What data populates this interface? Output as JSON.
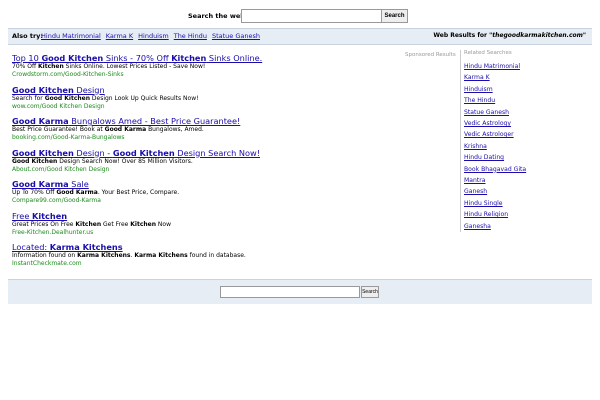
{
  "top_search": {
    "label": "Search the web:",
    "value": "",
    "button": "Search"
  },
  "also_try": {
    "label": "Also try:",
    "links": [
      "Hindu Matrimonial",
      "Karma K",
      "Hinduism",
      "The Hindu",
      "Statue Ganesh"
    ]
  },
  "web_results": {
    "prefix": "Web Results for",
    "query": "\"thegoodkarmakitchen.com\""
  },
  "sponsored_label": "Sponsored Results",
  "results": [
    {
      "title_parts": [
        [
          "Top 10 ",
          false
        ],
        [
          "Good Kitchen",
          true
        ],
        [
          " Sinks - 70% Off ",
          false
        ],
        [
          "Kitchen",
          true
        ],
        [
          " Sinks Online.",
          false
        ]
      ],
      "desc_parts": [
        [
          "70% Off ",
          false
        ],
        [
          "Kitchen",
          true
        ],
        [
          " Sinks Online. Lowest Prices Listed - Save Now!",
          false
        ]
      ],
      "url": "Crowdstorm.com/Good-Kitchen-Sinks"
    },
    {
      "title_parts": [
        [
          "Good Kitchen",
          true
        ],
        [
          " Design",
          false
        ]
      ],
      "desc_parts": [
        [
          "Search for ",
          false
        ],
        [
          "Good Kitchen",
          true
        ],
        [
          " Design Look Up Quick Results Now!",
          false
        ]
      ],
      "url": "wow.com/Good Kitchen Design"
    },
    {
      "title_parts": [
        [
          "Good Karma",
          true
        ],
        [
          " Bungalows Amed - Best Price Guarantee!",
          false
        ]
      ],
      "desc_parts": [
        [
          "Best Price Guarantee! Book at ",
          false
        ],
        [
          "Good Karma",
          true
        ],
        [
          " Bungalows, Amed.",
          false
        ]
      ],
      "url": "booking.com/Good-Karma-Bungalows"
    },
    {
      "title_parts": [
        [
          "Good Kitchen",
          true
        ],
        [
          " Design - ",
          false
        ],
        [
          "Good Kitchen",
          true
        ],
        [
          " Design Search Now!",
          false
        ]
      ],
      "desc_parts": [
        [
          "Good Kitchen",
          true
        ],
        [
          " Design Search Now! Over 85 Million Visitors.",
          false
        ]
      ],
      "url": "About.com/Good Kitchen Design"
    },
    {
      "title_parts": [
        [
          "Good Karma",
          true
        ],
        [
          " Sale",
          false
        ]
      ],
      "desc_parts": [
        [
          "Up To 70% Off ",
          false
        ],
        [
          "Good Karma",
          true
        ],
        [
          ". Your Best Price, Compare.",
          false
        ]
      ],
      "url": "Compare99.com/Good-Karma"
    },
    {
      "title_parts": [
        [
          "Free ",
          false
        ],
        [
          "Kitchen",
          true
        ]
      ],
      "desc_parts": [
        [
          "Great Prices On Free ",
          false
        ],
        [
          "Kitchen",
          true
        ],
        [
          " Get Free ",
          false
        ],
        [
          "Kitchen",
          true
        ],
        [
          " Now",
          false
        ]
      ],
      "url": "Free-Kitchen.Dealhunter.us"
    },
    {
      "title_parts": [
        [
          "Located: ",
          false
        ],
        [
          "Karma Kitchens",
          true
        ]
      ],
      "desc_parts": [
        [
          "Information found on ",
          false
        ],
        [
          "Karma Kitchens",
          true
        ],
        [
          ". ",
          false
        ],
        [
          "Karma Kitchens",
          true
        ],
        [
          " found in database.",
          false
        ]
      ],
      "url": "InstantCheckmate.com"
    }
  ],
  "related": {
    "heading": "Related Searches",
    "links": [
      "Hindu Matrimonial",
      "Karma K",
      "Hinduism",
      "The Hindu",
      "Statue Ganesh",
      "Vedic Astrology",
      "Vedic Astrologer",
      "Krishna",
      "Hindu Dating",
      "Book Bhagavad Gita",
      "Mantra",
      "Ganesh",
      "Hindu Single",
      "Hindu Religion",
      "Ganesha"
    ]
  },
  "bottom_search": {
    "value": "",
    "button": "Search"
  },
  "colors": {
    "link": "#1a0dab",
    "url_green": "#1c8a1c",
    "bar_bg": "#e6edf5"
  }
}
